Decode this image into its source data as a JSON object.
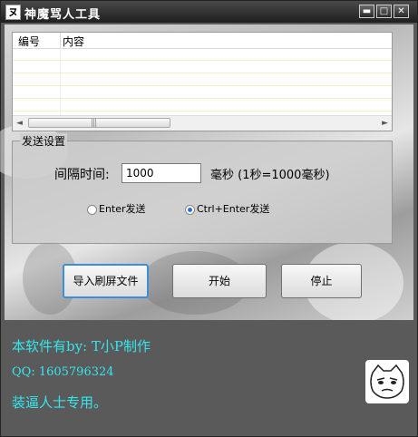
{
  "window": {
    "title": "神魔骂人工具",
    "min_glyph": "▬",
    "max_glyph": "□",
    "close_glyph": "✕"
  },
  "list": {
    "columns": [
      "编号",
      "内容"
    ],
    "scroll_left": "◄",
    "scroll_right": "►",
    "grip": "|||"
  },
  "settings": {
    "group_label": "发送设置",
    "interval_label": "间隔时间:",
    "interval_value": "1000",
    "unit_label": "毫秒 (1秒=1000毫秒)",
    "radio_enter": "Enter发送",
    "radio_ctrl_enter": "Ctrl+Enter发送",
    "selected": "Ctrl+Enter发送"
  },
  "buttons": {
    "import": "导入刷屏文件",
    "start": "开始",
    "stop": "停止"
  },
  "info": {
    "line1": "本软件有by: T小P制作",
    "line2": "QQ: 1605796324",
    "line3": "装逼人士专用。"
  },
  "icons": {
    "app": "app-icon",
    "avatar": "cat-face-icon"
  }
}
